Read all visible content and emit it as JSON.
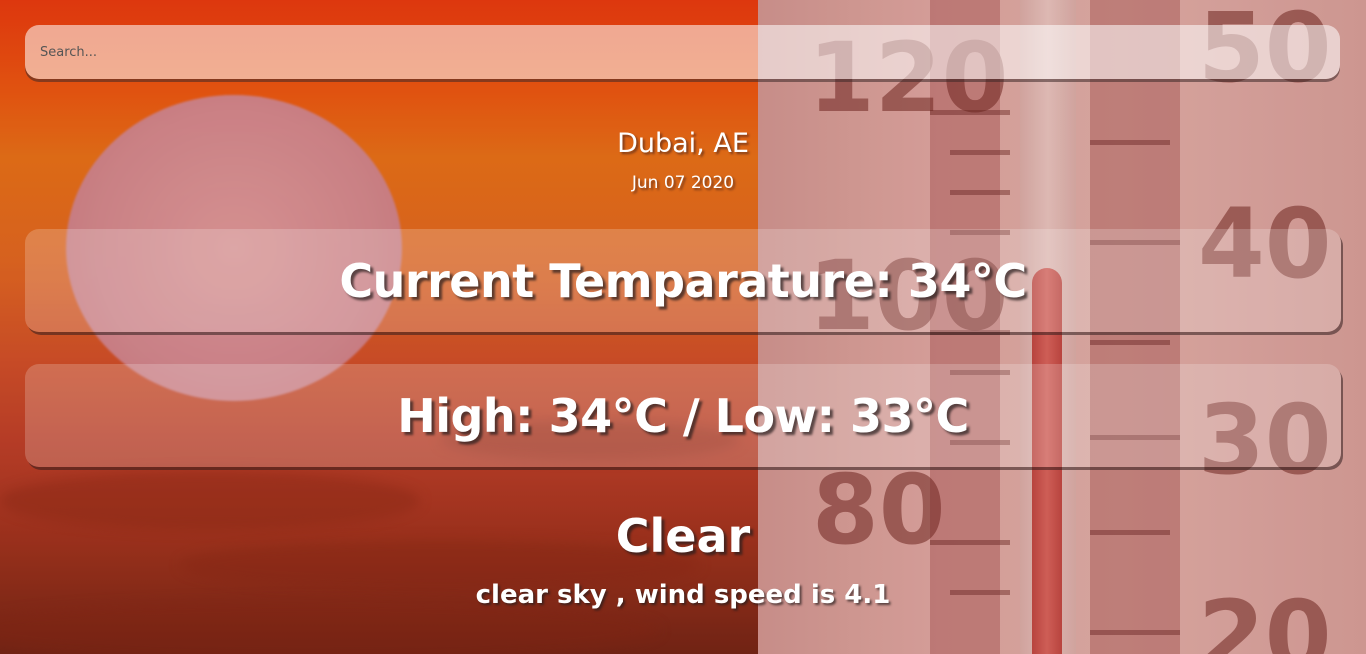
{
  "search": {
    "placeholder": "Search...",
    "value": ""
  },
  "location": {
    "city": "Dubai, AE",
    "date": "Jun 07 2020"
  },
  "weather": {
    "current_temp": "Current Temparature: 34°C",
    "high_low": "High: 34°C / Low: 33°C",
    "condition": "Clear",
    "description": "clear sky , wind speed is 4.1"
  },
  "background": {
    "thermometer_numbers": [
      "120",
      "100",
      "80",
      "50",
      "40",
      "30",
      "20"
    ],
    "colors": {
      "sky_top": "#f03c10",
      "sky_mid": "#ef7318",
      "sun": "#dc8f98",
      "thermometer": "#e6aba5"
    }
  }
}
